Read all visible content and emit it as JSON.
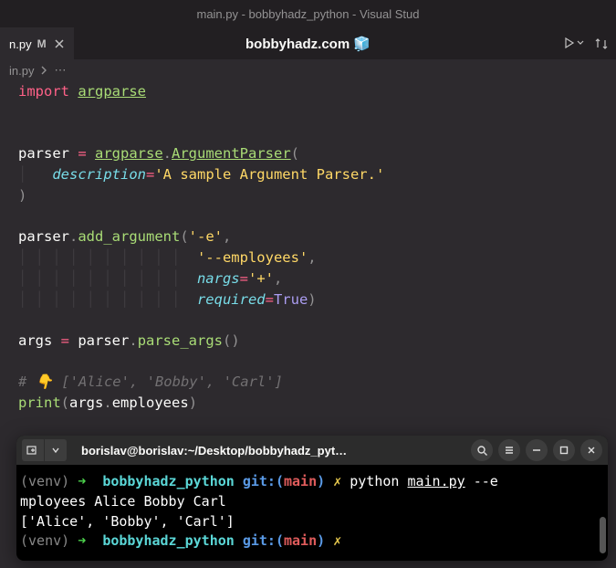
{
  "window": {
    "title": "main.py - bobbyhadz_python - Visual Stud"
  },
  "tab": {
    "name": "n.py",
    "modified": "M",
    "center_title": "bobbyhadz.com 🧊"
  },
  "breadcrumb": {
    "file": "in.py",
    "sep": "",
    "rest": "⋯"
  },
  "code": {
    "l1": {
      "kw": "import",
      "sp": " ",
      "mod": "argparse"
    },
    "l4a": "parser ",
    "l4b": "=",
    "l4c": " ",
    "l4d": "argparse",
    "l4e": ".",
    "l4f": "ArgumentParser",
    "l4g": "(",
    "l5pad": "│   ",
    "l5a": "description",
    "l5b": "=",
    "l5c": "'A sample Argument Parser.'",
    "l6": ")",
    "l8a": "parser",
    "l8b": ".",
    "l8c": "add_argument",
    "l8d": "(",
    "l8e": "'-e'",
    "l8f": ",",
    "l9pad": "│ │ │ │ │ │ │ │ │ │  ",
    "l9a": "'--employees'",
    "l9b": ",",
    "l10a": "nargs",
    "l10b": "=",
    "l10c": "'+'",
    "l10d": ",",
    "l11a": "required",
    "l11b": "=",
    "l11c": "True",
    "l11d": ")",
    "l13a": "args ",
    "l13b": "=",
    "l13c": " parser",
    "l13d": ".",
    "l13e": "parse_args",
    "l13f": "()",
    "l15": "# 👇️ ['Alice', 'Bobby', 'Carl']",
    "l16a": "print",
    "l16b": "(",
    "l16c": "args",
    "l16d": ".",
    "l16e": "employees",
    "l16f": ")"
  },
  "terminal": {
    "title": "borislav@borislav:~/Desktop/bobbyhadz_pyt…",
    "venv": "(venv)",
    "arrow": "➜",
    "dir": "bobbyhadz_python",
    "git_label": "git:(",
    "branch": "main",
    "git_close": ")",
    "x": "✗",
    "cmd_python": "python",
    "cmd_file": "main.py",
    "cmd_args": " --e",
    "line2": "mployees Alice Bobby Carl",
    "output": "['Alice', 'Bobby', 'Carl']"
  }
}
